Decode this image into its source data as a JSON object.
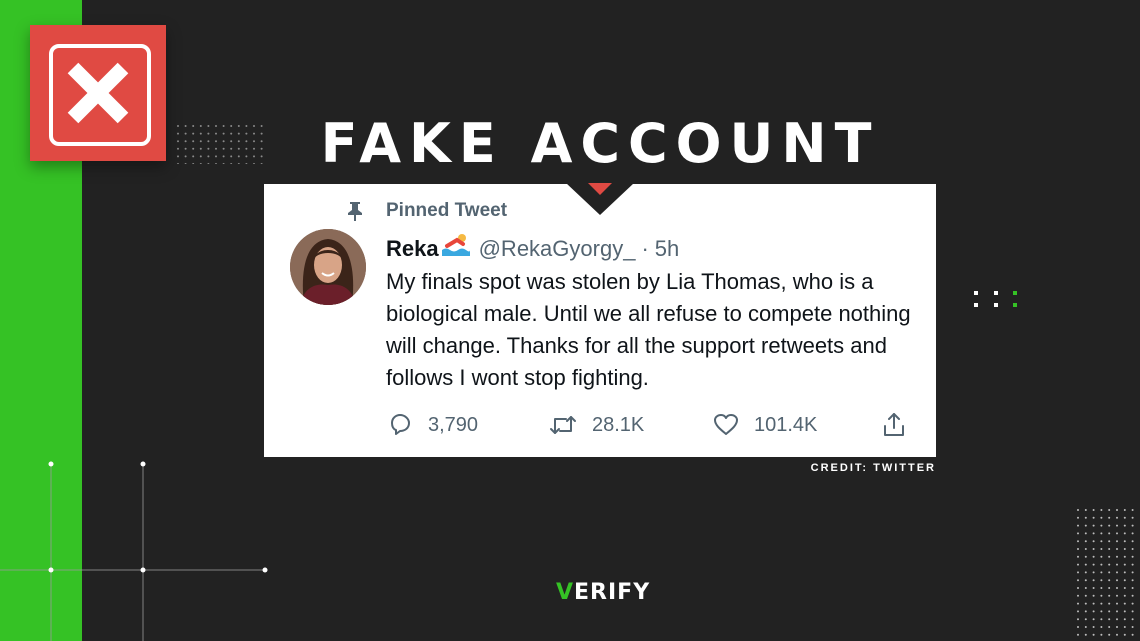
{
  "colors": {
    "background": "#222222",
    "accent_green": "#35c225",
    "badge_red": "#e04a43",
    "card": "#ffffff",
    "text_primary": "#0f1419",
    "text_secondary": "#536471"
  },
  "badge": {
    "icon": "x-mark-icon"
  },
  "headline": "FAKE ACCOUNT",
  "tweet": {
    "pinned_label": "Pinned Tweet",
    "display_name": "Reka",
    "handle": "@RekaGyorgy_",
    "separator": "·",
    "timestamp": "5h",
    "text": "My finals spot was stolen by Lia Thomas, who is a biological male. Until we all refuse to compete nothing will change. Thanks for all the support retweets and follows I wont stop fighting.",
    "actions": [
      {
        "icon": "reply-icon",
        "count": "3,790"
      },
      {
        "icon": "retweet-icon",
        "count": "28.1K"
      },
      {
        "icon": "like-icon",
        "count": "101.4K"
      },
      {
        "icon": "share-icon",
        "count": ""
      }
    ]
  },
  "credit": "CREDIT: TWITTER",
  "logo": {
    "first_letter": "V",
    "rest": "ERIFY"
  }
}
